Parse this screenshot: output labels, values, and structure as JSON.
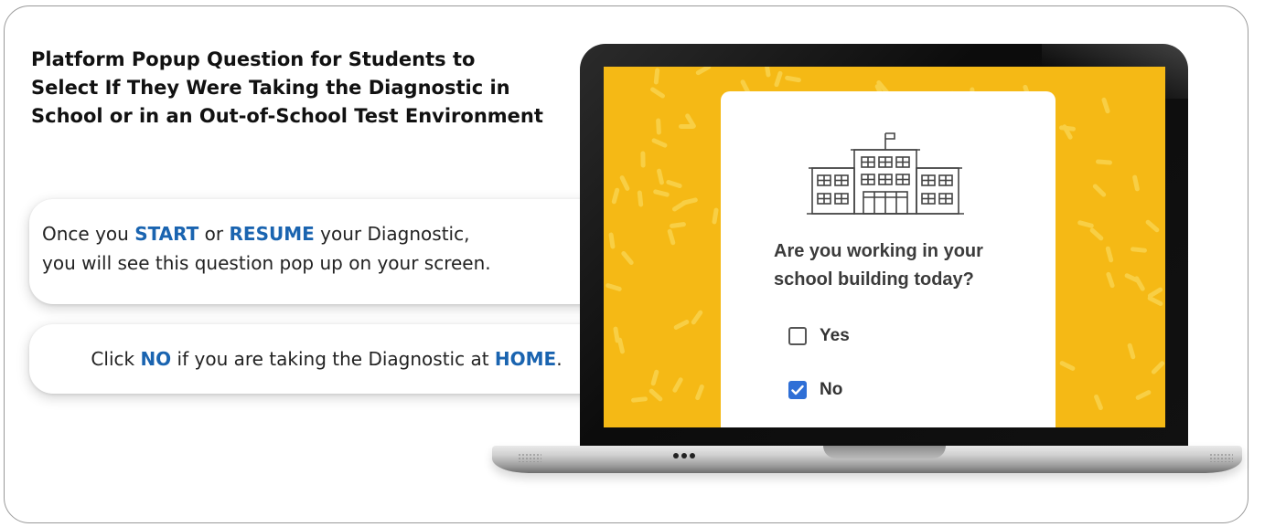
{
  "heading": "Platform Popup Question for Students to Select If They Were Taking the Diagnostic in School or in an Out-of-School Test Environment",
  "callout_resume": {
    "part1": "Once you ",
    "start": "START",
    "part2": " or ",
    "resume": "RESUME",
    "part3": " your Diagnostic,",
    "line2": "you will see this question pop up on your screen."
  },
  "callout_home": {
    "part1": "Click ",
    "no": "NO",
    "part2": " if you are taking the Diagnostic at ",
    "home": "HOME",
    "part3": "."
  },
  "dialog": {
    "icon": "school-building-icon",
    "question": "Are you working in your school building today?",
    "options": [
      {
        "label": "Yes",
        "checked": false
      },
      {
        "label": "No",
        "checked": true
      }
    ]
  },
  "colors": {
    "accent": "#1a64b0",
    "screen_bg": "#f5b915",
    "checkbox_checked": "#2f6fd6"
  }
}
